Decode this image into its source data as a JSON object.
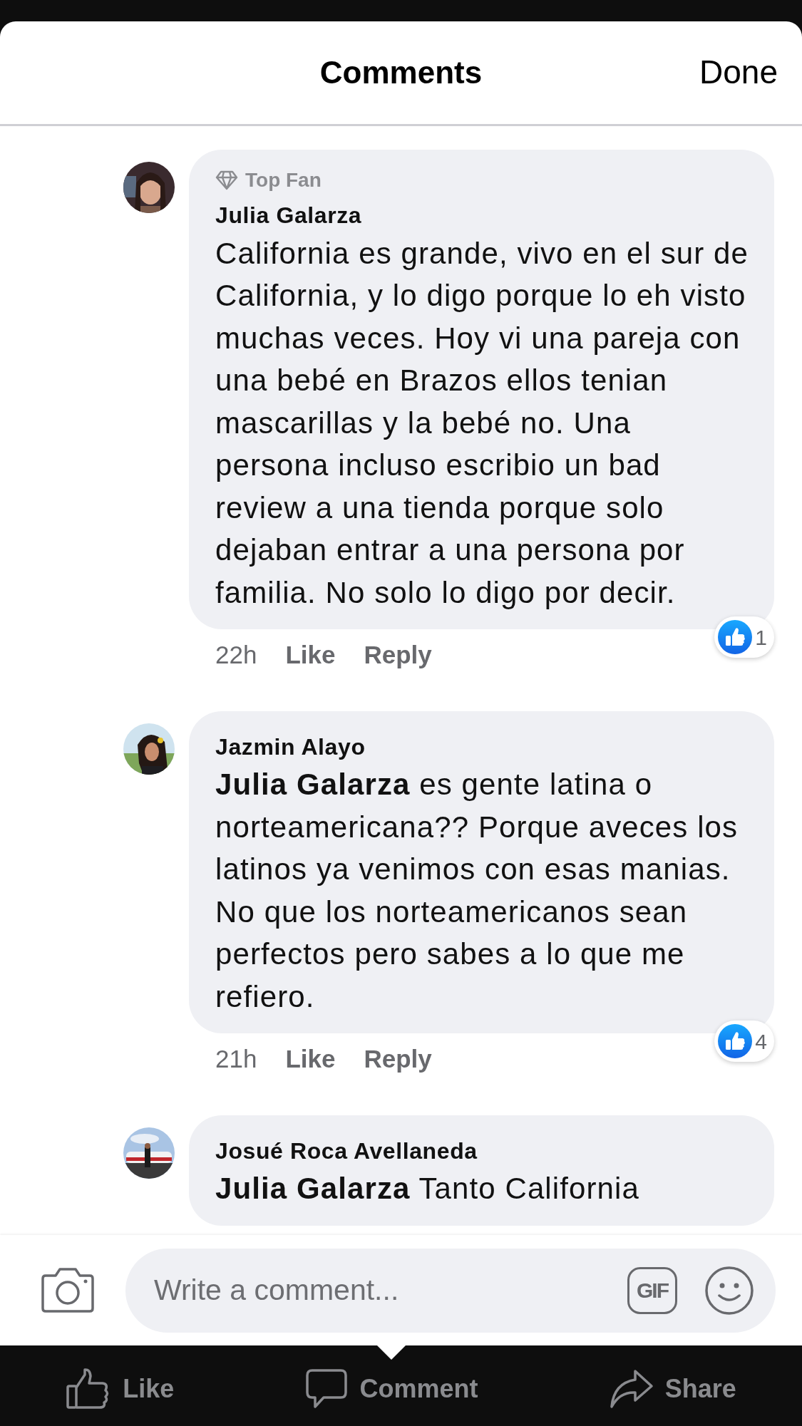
{
  "header": {
    "title": "Comments",
    "done": "Done"
  },
  "comments": [
    {
      "badge": "Top Fan",
      "author": "Julia Galarza",
      "text": "California es grande, vivo en el sur de California, y lo digo porque lo eh visto muchas veces. Hoy vi una pareja con una bebé en Brazos ellos tenian mascarillas y la bebé no. Una persona incluso escribio un bad review a una tienda porque solo dejaban entrar a una persona por familia. No solo lo digo por decir.",
      "time": "22h",
      "like": "Like",
      "reply": "Reply",
      "reactions": "1"
    },
    {
      "author": "Jazmin Alayo",
      "text": "**Julia Galarza**  es gente latina o norteamericana?? Porque aveces los latinos ya venimos con esas manias. No que los norteamericanos sean perfectos pero sabes a lo que me refiero.",
      "time": "21h",
      "like": "Like",
      "reply": "Reply",
      "reactions": "4"
    },
    {
      "author": "Josué Roca Avellaneda",
      "text": "**Julia Galarza** Tanto California"
    }
  ],
  "composer": {
    "placeholder": "Write a comment...",
    "gif": "GIF"
  },
  "actions": [
    {
      "label": "Like",
      "selected": false
    },
    {
      "label": "Comment",
      "selected": true
    },
    {
      "label": "Share",
      "selected": false
    }
  ]
}
